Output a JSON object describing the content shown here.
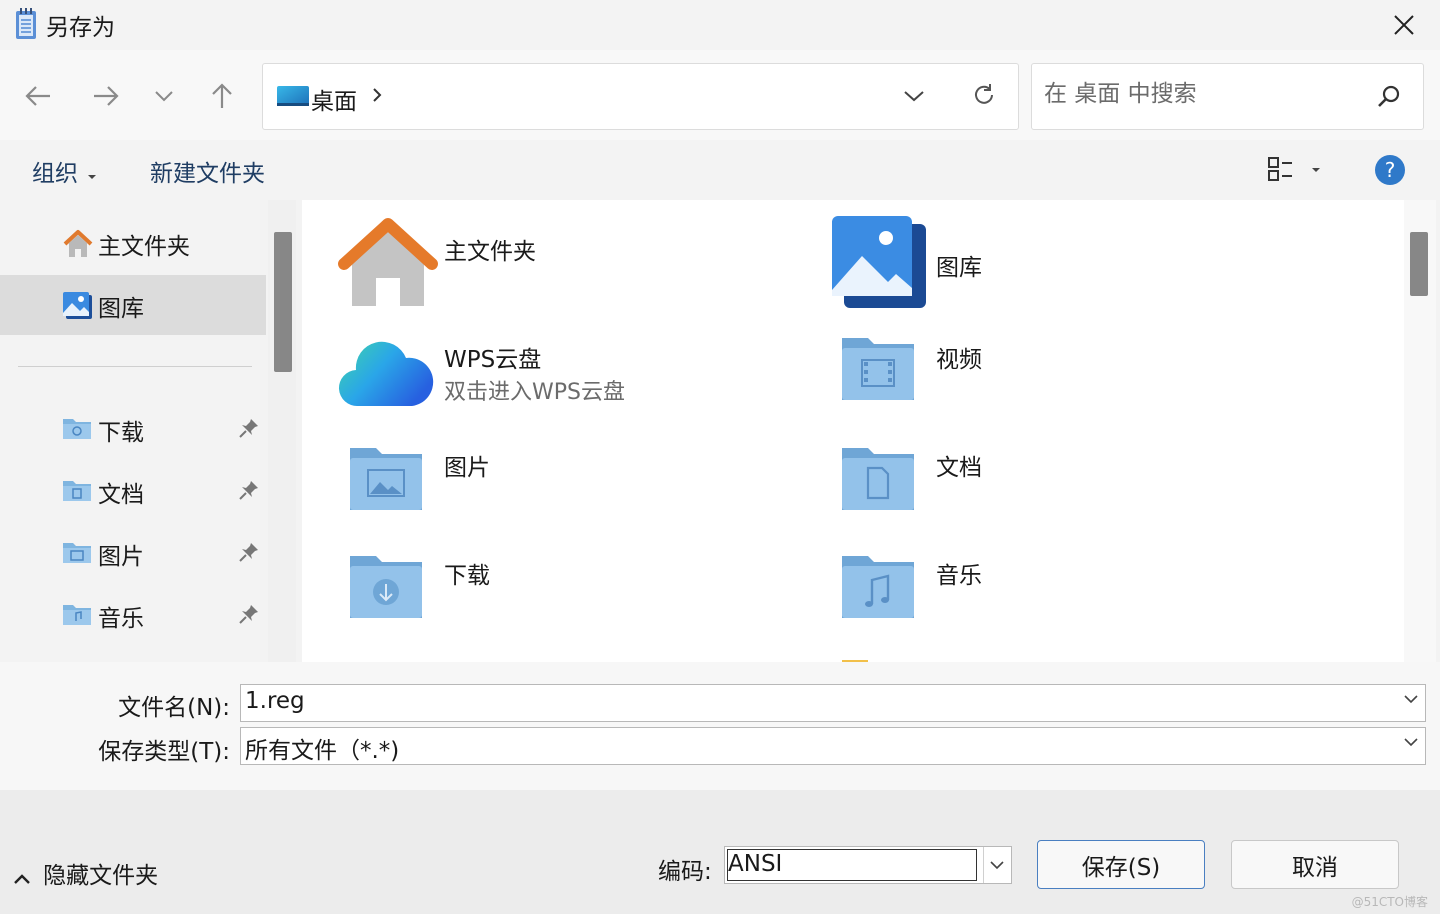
{
  "window": {
    "title": "另存为"
  },
  "nav": {
    "breadcrumb": "桌面",
    "search_placeholder": "在 桌面 中搜索"
  },
  "toolbar": {
    "organize_label": "组织",
    "new_folder_label": "新建文件夹"
  },
  "sidebar": {
    "items": [
      {
        "label": "主文件夹",
        "icon": "home-icon",
        "selected": false,
        "pinned": false
      },
      {
        "label": "图库",
        "icon": "gallery-icon",
        "selected": true,
        "pinned": false
      },
      {
        "label": "下载",
        "icon": "download-folder-icon",
        "selected": false,
        "pinned": true
      },
      {
        "label": "文档",
        "icon": "document-folder-icon",
        "selected": false,
        "pinned": true
      },
      {
        "label": "图片",
        "icon": "picture-folder-icon",
        "selected": false,
        "pinned": true
      },
      {
        "label": "音乐",
        "icon": "music-folder-icon",
        "selected": false,
        "pinned": true
      }
    ]
  },
  "content": {
    "items": [
      {
        "label": "主文件夹",
        "icon": "home-icon"
      },
      {
        "label": "图库",
        "icon": "gallery-icon"
      },
      {
        "label": "WPS云盘",
        "sub": "双击进入WPS云盘",
        "icon": "wps-cloud-icon"
      },
      {
        "label": "视频",
        "icon": "video-folder-icon"
      },
      {
        "label": "图片",
        "icon": "picture-folder-icon"
      },
      {
        "label": "文档",
        "icon": "document-folder-icon"
      },
      {
        "label": "下载",
        "icon": "download-folder-icon"
      },
      {
        "label": "音乐",
        "icon": "music-folder-icon"
      }
    ]
  },
  "form": {
    "filename_label": "文件名(N):",
    "filename_value": "1.reg",
    "filetype_label": "保存类型(T):",
    "filetype_value": "所有文件（*.*)"
  },
  "footer": {
    "hide_folders_label": "隐藏文件夹",
    "encoding_label": "编码:",
    "encoding_value": "ANSI",
    "save_label": "保存(S)",
    "cancel_label": "取消",
    "watermark": "@51CTO博客"
  },
  "colors": {
    "folder": "#7fb5e0",
    "accent": "#2f79c9",
    "help": "#2f79c9"
  }
}
